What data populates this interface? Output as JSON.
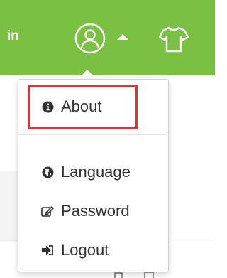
{
  "header": {
    "partial_text": "in",
    "user_icon": "user-circle-icon",
    "caret_icon": "caret-up-icon",
    "shirt_icon": "tshirt-icon"
  },
  "menu": {
    "items": [
      {
        "label": "About",
        "icon": "info-circle-icon"
      },
      {
        "label": "Language",
        "icon": "globe-icon"
      },
      {
        "label": "Password",
        "icon": "edit-icon"
      },
      {
        "label": "Logout",
        "icon": "sign-out-icon"
      }
    ]
  },
  "colors": {
    "brand_green": "#7ac143",
    "highlight_red": "#e23333",
    "text": "#333333"
  }
}
